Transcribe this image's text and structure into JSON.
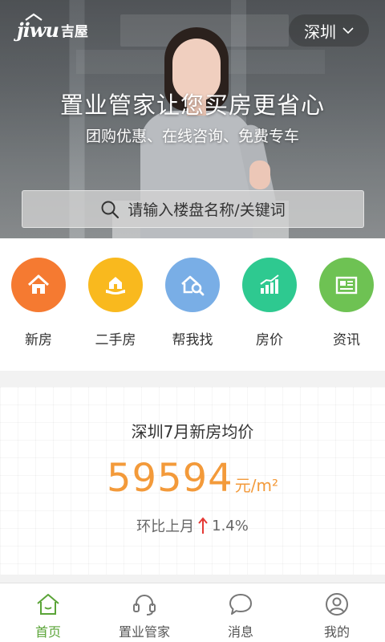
{
  "header": {
    "logo_text": "jiwu",
    "logo_cn": "吉屋",
    "city": "深圳"
  },
  "hero": {
    "title": "置业管家让您买房更省心",
    "subtitle": "团购优惠、在线咨询、免费专车"
  },
  "search": {
    "placeholder": "请输入楼盘名称/关键词"
  },
  "quick_nav": [
    {
      "label": "新房",
      "icon": "house-icon",
      "color": "#f57a31"
    },
    {
      "label": "二手房",
      "icon": "house-hand-icon",
      "color": "#f9b91e"
    },
    {
      "label": "帮我找",
      "icon": "house-search-icon",
      "color": "#79aee6"
    },
    {
      "label": "房价",
      "icon": "bar-chart-icon",
      "color": "#2ec990"
    },
    {
      "label": "资讯",
      "icon": "newspaper-icon",
      "color": "#6ec253"
    }
  ],
  "price": {
    "title": "深圳7月新房均价",
    "value": "59594",
    "unit": "元/m²",
    "change_label": "环比上月",
    "change_value": "1.4%",
    "trend": "up",
    "trend_color": "#e53935"
  },
  "tabs": [
    {
      "label": "首页",
      "icon": "home-icon",
      "active": true
    },
    {
      "label": "置业管家",
      "icon": "headset-icon",
      "active": false
    },
    {
      "label": "消息",
      "icon": "chat-bubble-icon",
      "active": false
    },
    {
      "label": "我的",
      "icon": "user-icon",
      "active": false
    }
  ],
  "colors": {
    "accent_green": "#5aa437",
    "price_orange": "#f39a3a"
  }
}
